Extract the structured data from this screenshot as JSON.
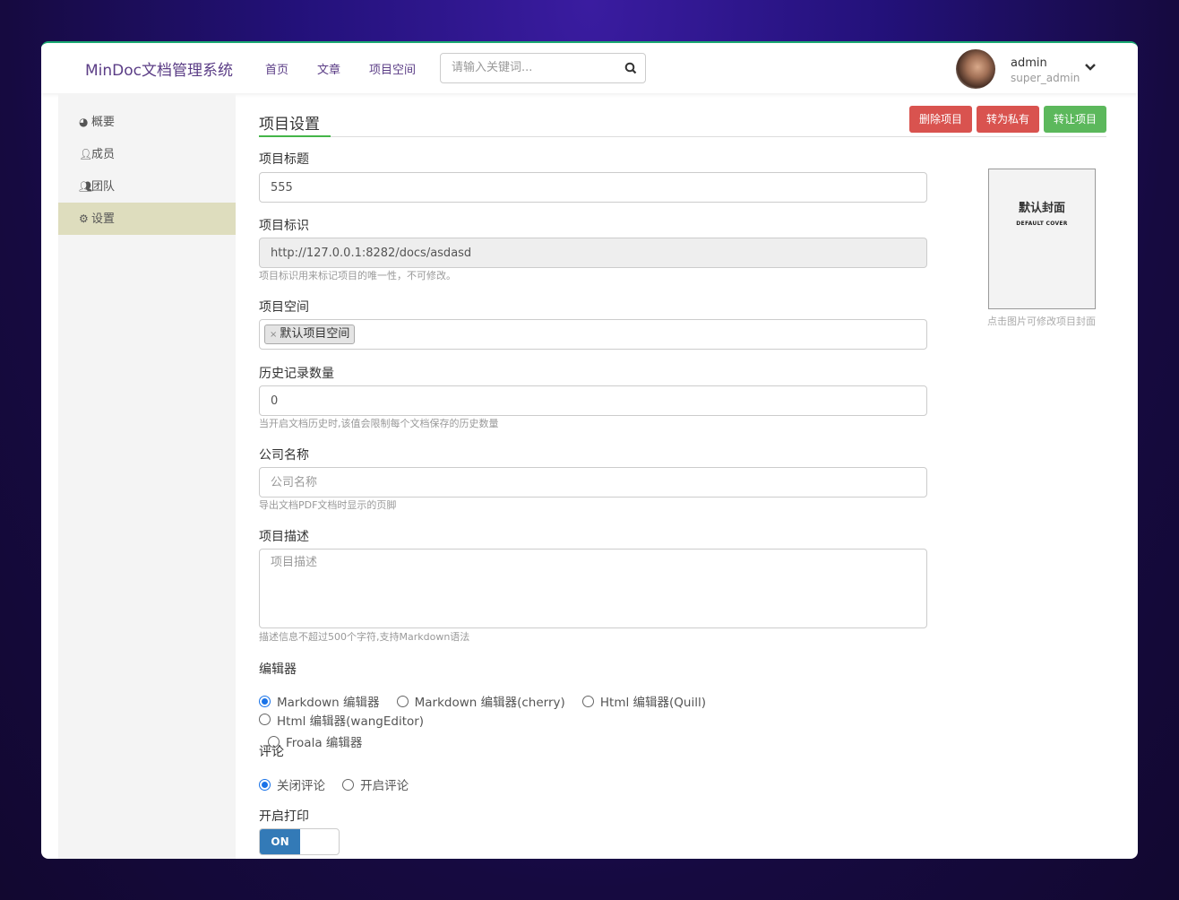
{
  "header": {
    "brand": "MinDoc文档管理系统",
    "nav": [
      "首页",
      "文章",
      "项目空间"
    ],
    "search_placeholder": "请输入关键词...",
    "user": {
      "name": "admin",
      "role": "super_admin"
    }
  },
  "sidebar": {
    "items": [
      {
        "label": "概要",
        "icon": "dashboard-icon"
      },
      {
        "label": "成员",
        "icon": "user-icon"
      },
      {
        "label": "团队",
        "icon": "users-icon"
      },
      {
        "label": "设置",
        "icon": "gear-icon",
        "active": true
      }
    ]
  },
  "main": {
    "title": "项目设置",
    "buttons": {
      "delete": "删除项目",
      "private": "转为私有",
      "transfer": "转让项目"
    },
    "fields": {
      "title": {
        "label": "项目标题",
        "value": "555"
      },
      "identify": {
        "label": "项目标识",
        "value": "http://127.0.0.1:8282/docs/asdasd",
        "help": "项目标识用来标记项目的唯一性，不可修改。"
      },
      "space": {
        "label": "项目空间",
        "tag": "默认项目空间"
      },
      "history": {
        "label": "历史记录数量",
        "value": "0",
        "help": "当开启文档历史时,该值会限制每个文档保存的历史数量"
      },
      "company": {
        "label": "公司名称",
        "placeholder": "公司名称",
        "help": "导出文档PDF文档时显示的页脚"
      },
      "description": {
        "label": "项目描述",
        "placeholder": "项目描述",
        "help": "描述信息不超过500个字符,支持Markdown语法"
      },
      "editor": {
        "label": "编辑器",
        "options": [
          "Markdown 编辑器",
          "Markdown 编辑器(cherry)",
          "Html 编辑器(Quill)",
          "Html 编辑器(wangEditor)",
          "Froala 编辑器"
        ],
        "selected": "Markdown 编辑器"
      },
      "comment": {
        "label": "评论",
        "options": [
          "关闭评论",
          "开启评论"
        ],
        "selected": "关闭评论"
      },
      "print": {
        "label": "开启打印",
        "toggle": "ON"
      }
    },
    "cover": {
      "title_cn": "默认封面",
      "title_en": "DEFAULT COVER",
      "caption": "点击图片可修改项目封面"
    }
  },
  "colors": {
    "brand": "#5b3d86",
    "danger": "#d9534f",
    "success": "#5cb85c",
    "primary": "#337ab7",
    "active_sidebar": "#deddbe"
  }
}
